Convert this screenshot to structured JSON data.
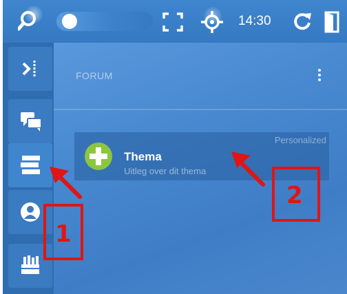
{
  "status_bar": {
    "clock": "14:30",
    "icons": [
      "search-icon",
      "toggle-switch",
      "fullscreen-icon",
      "crosshair-icon",
      "refresh-icon",
      "exit-icon"
    ]
  },
  "sidebar": {
    "items": [
      {
        "icon": "collapse-panel-icon"
      },
      {
        "icon": "chat-bubbles-icon"
      },
      {
        "icon": "forum-list-icon",
        "active": true
      },
      {
        "icon": "user-profile-icon"
      },
      {
        "icon": "toolbox-icon"
      }
    ]
  },
  "main": {
    "section_title": "FORUM",
    "topic": {
      "title": "Thema",
      "subtitle": "Uitleg over dit thema",
      "badge": "Personalized"
    }
  },
  "annotations": {
    "label_1": "1",
    "label_2": "2",
    "color": "#e01515"
  },
  "colors": {
    "topbar": "#3f86cf",
    "sidebar": "#2f6cb0",
    "accent_green": "#8cc63f"
  }
}
